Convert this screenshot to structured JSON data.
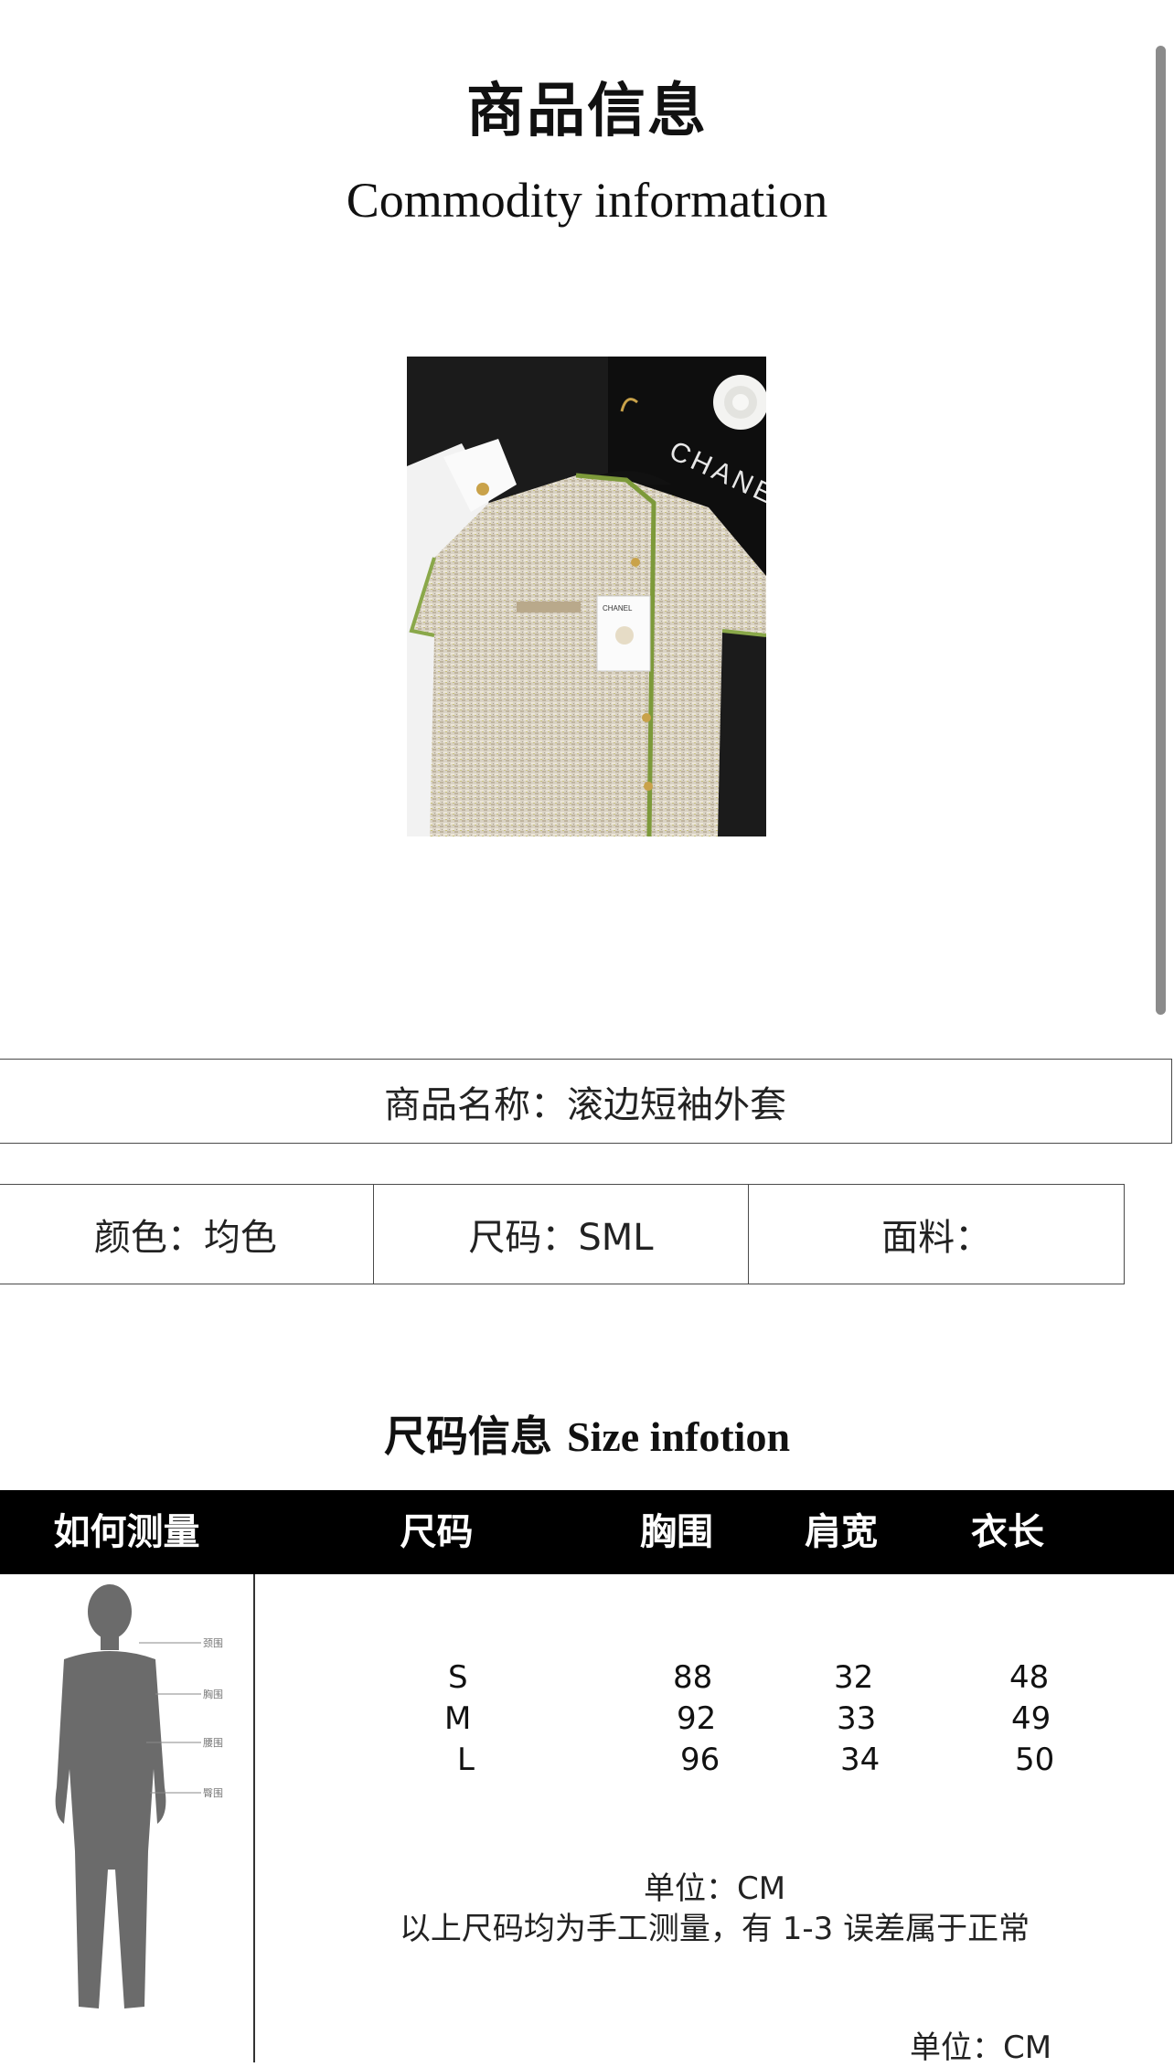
{
  "header": {
    "title_cn": "商品信息",
    "title_en": "Commodity information"
  },
  "product": {
    "image_icon": "tweed-short-sleeve-jacket-photo",
    "hanger_brand": "CHANEL",
    "hang_tag_brand": "CHANEL"
  },
  "info": {
    "name": "商品名称：滚边短袖外套",
    "color": "颜色：均色",
    "size": "尺码：SML",
    "fabric": "面料："
  },
  "size_section": {
    "title_cn": "尺码信息",
    "title_en": "Size infotion"
  },
  "table": {
    "headers": [
      "如何测量",
      "尺码",
      "胸围",
      "肩宽",
      "衣长"
    ],
    "rows": [
      {
        "size": "S",
        "chest": "88",
        "shoulder": "32",
        "length": "48"
      },
      {
        "size": "M",
        "chest": "92",
        "shoulder": "33",
        "length": "49"
      },
      {
        "size": "L",
        "chest": "96",
        "shoulder": "34",
        "length": "50"
      }
    ],
    "measure_labels": [
      "颈围",
      "胸围",
      "腰围",
      "臀围"
    ]
  },
  "notes": {
    "unit": "单位：CM",
    "disclaimer": "以上尺码均为手工测量，有 1-3 误差属于正常",
    "unit_bottom": "单位：CM"
  },
  "colors": {
    "header_bg": "#000000",
    "border": "#4a4a4a",
    "silhouette": "#6b6b6b"
  }
}
